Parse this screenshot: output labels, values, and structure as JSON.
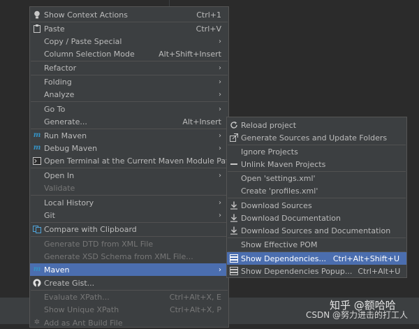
{
  "main_menu": [
    {
      "label": "Show Context Actions",
      "shortcut": "Ctrl+1",
      "icon": "bulb-icon"
    },
    {
      "label": "Paste",
      "shortcut": "Ctrl+V",
      "icon": "clipboard-icon"
    },
    {
      "label": "Copy / Paste Special",
      "submenu": true
    },
    {
      "label": "Column Selection Mode",
      "shortcut": "Alt+Shift+Insert"
    },
    {
      "label": "Refactor",
      "submenu": true
    },
    {
      "label": "Folding",
      "submenu": true
    },
    {
      "label": "Analyze",
      "submenu": true
    },
    {
      "label": "Go To",
      "submenu": true
    },
    {
      "label": "Generate...",
      "shortcut": "Alt+Insert"
    },
    {
      "label": "Run Maven",
      "icon": "maven-icon",
      "submenu": true
    },
    {
      "label": "Debug Maven",
      "icon": "maven-icon",
      "submenu": true
    },
    {
      "label": "Open Terminal at the Current Maven Module Path",
      "icon": "terminal-icon"
    },
    {
      "label": "Open In",
      "submenu": true
    },
    {
      "label": "Validate",
      "disabled": true
    },
    {
      "label": "Local History",
      "submenu": true
    },
    {
      "label": "Git",
      "submenu": true
    },
    {
      "label": "Compare with Clipboard",
      "icon": "compare-icon"
    },
    {
      "label": "Generate DTD from XML File",
      "disabled": true
    },
    {
      "label": "Generate XSD Schema from XML File...",
      "disabled": true
    },
    {
      "label": "Maven",
      "icon": "maven-icon",
      "submenu": true,
      "selected": true
    },
    {
      "label": "Create Gist...",
      "icon": "github-icon"
    },
    {
      "label": "Evaluate XPath...",
      "shortcut": "Ctrl+Alt+X, E",
      "disabled": true
    },
    {
      "label": "Show Unique XPath",
      "shortcut": "Ctrl+Alt+X, P",
      "disabled": true
    },
    {
      "label": "Add as Ant Build File",
      "disabled": true,
      "icon": "ant-icon"
    }
  ],
  "sub_menu": [
    {
      "label": "Reload project",
      "icon": "reload-icon"
    },
    {
      "label": "Generate Sources and Update Folders",
      "icon": "generate-sources-icon"
    },
    {
      "label": "Ignore Projects"
    },
    {
      "label": "Unlink Maven Projects",
      "icon": "minus-icon"
    },
    {
      "label": "Open 'settings.xml'"
    },
    {
      "label": "Create 'profiles.xml'"
    },
    {
      "label": "Download Sources",
      "icon": "download-icon"
    },
    {
      "label": "Download Documentation",
      "icon": "download-icon"
    },
    {
      "label": "Download Sources and Documentation",
      "icon": "download-icon"
    },
    {
      "label": "Show Effective POM"
    },
    {
      "label": "Show Dependencies...",
      "shortcut": "Ctrl+Alt+Shift+U",
      "icon": "dependencies-icon",
      "selected": true
    },
    {
      "label": "Show Dependencies Popup...",
      "shortcut": "Ctrl+Alt+U",
      "icon": "dependencies-icon"
    }
  ],
  "watermark": {
    "line1": "知乎 @额哈哈",
    "line2": "CSDN @努力进击的打工人"
  },
  "colors": {
    "menu_bg": "#3c3f41",
    "selected": "#4b6eaf",
    "maven_icon": "#3592c4"
  }
}
